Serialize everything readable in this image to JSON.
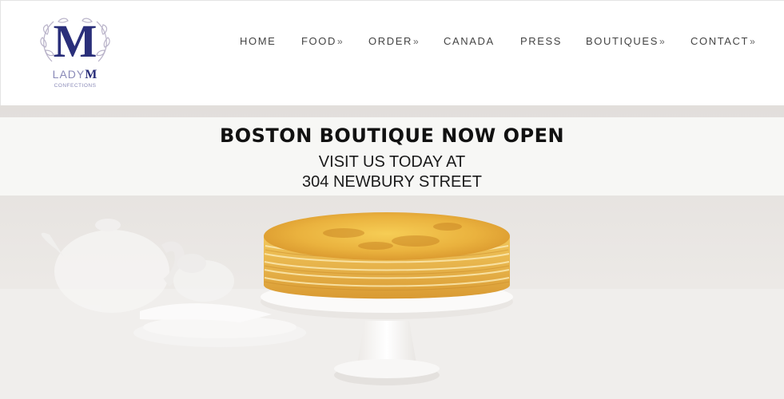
{
  "brand": {
    "monogram": "M",
    "name_light": "LADY",
    "name_bold": "M",
    "tagline": "CONFECTIONS"
  },
  "nav": {
    "items": [
      {
        "label": "HOME",
        "has_submenu": false
      },
      {
        "label": "FOOD",
        "has_submenu": true
      },
      {
        "label": "ORDER",
        "has_submenu": true
      },
      {
        "label": "CANADA",
        "has_submenu": false
      },
      {
        "label": "PRESS",
        "has_submenu": false
      },
      {
        "label": "BOUTIQUES",
        "has_submenu": true
      },
      {
        "label": "CONTACT",
        "has_submenu": true
      }
    ],
    "submenu_marker": "»"
  },
  "hero": {
    "title": "BOSTON BOUTIQUE NOW OPEN",
    "line1": "VISIT US TODAY AT",
    "line2": "304 NEWBURY STREET"
  },
  "colors": {
    "brand_navy": "#2a2f7a",
    "brand_lavender": "#8a8ab8",
    "nav_text": "#444444",
    "cake_gold": "#e8b43a"
  }
}
